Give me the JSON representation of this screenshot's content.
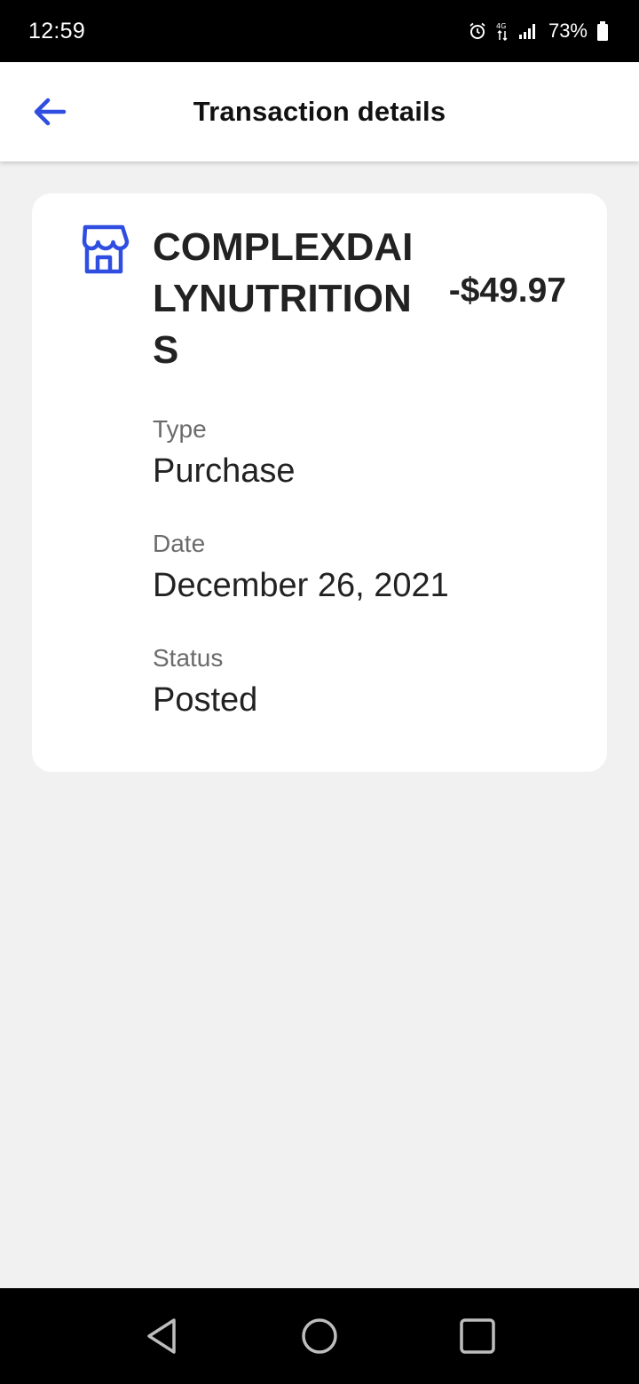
{
  "status_bar": {
    "time": "12:59",
    "battery": "73%",
    "icons": [
      "alarm-icon",
      "data-icon",
      "signal-icon",
      "battery-icon"
    ]
  },
  "header": {
    "title": "Transaction details",
    "back_icon": "arrow-left-icon"
  },
  "transaction": {
    "merchant_icon": "store-icon",
    "merchant": "COMPLEXDAILYNUTRITIONS",
    "amount": "-$49.97",
    "fields": [
      {
        "label": "Type",
        "value": "Purchase"
      },
      {
        "label": "Date",
        "value": "December 26, 2021"
      },
      {
        "label": "Status",
        "value": "Posted"
      }
    ]
  },
  "nav_bar": {
    "buttons": [
      "back-icon",
      "home-icon",
      "recents-icon"
    ]
  },
  "colors": {
    "accent": "#2f4de0",
    "background": "#f1f1f1",
    "card": "#ffffff",
    "label": "#6b6b6b"
  }
}
